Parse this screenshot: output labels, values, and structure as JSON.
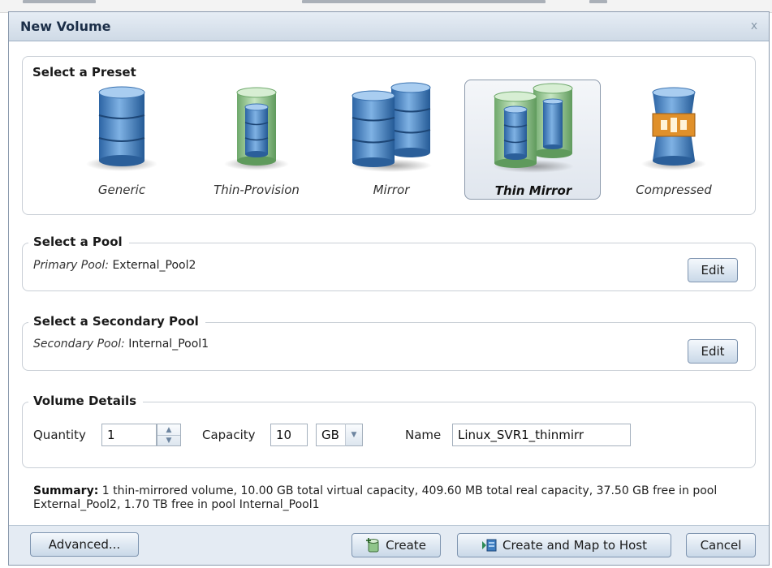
{
  "window": {
    "title": "New Volume",
    "close_glyph": "x"
  },
  "presets": {
    "heading": "Select a Preset",
    "items": [
      {
        "label": "Generic",
        "icon": "database-icon",
        "selected": false
      },
      {
        "label": "Thin-Provision",
        "icon": "thin-database-icon",
        "selected": false
      },
      {
        "label": "Mirror",
        "icon": "mirror-database-icon",
        "selected": false
      },
      {
        "label": "Thin Mirror",
        "icon": "thin-mirror-database-icon",
        "selected": true
      },
      {
        "label": "Compressed",
        "icon": "compressed-database-icon",
        "selected": false
      }
    ]
  },
  "pool": {
    "heading": "Select a Pool",
    "label": "Primary Pool:",
    "value": "External_Pool2",
    "edit_label": "Edit"
  },
  "secondary_pool": {
    "heading": "Select a Secondary Pool",
    "label": "Secondary Pool:",
    "value": "Internal_Pool1",
    "edit_label": "Edit"
  },
  "details": {
    "heading": "Volume Details",
    "quantity_label": "Quantity",
    "quantity_value": "1",
    "capacity_label": "Capacity",
    "capacity_value": "10",
    "unit_value": "GB",
    "name_label": "Name",
    "name_value": "Linux_SVR1_thinmirr"
  },
  "summary": {
    "label": "Summary:",
    "text": "1 thin-mirrored volume, 10.00 GB total virtual capacity, 409.60 MB total real capacity, 37.50 GB free in pool External_Pool2, 1.70 TB free in pool Internal_Pool1"
  },
  "footer": {
    "advanced_label": "Advanced...",
    "create_label": "Create",
    "create_map_label": "Create and Map to Host",
    "cancel_label": "Cancel"
  },
  "colors": {
    "blue_disk": "#3f7fc2",
    "green_disk": "#8fc58a",
    "compressed_band": "#e0902a",
    "title_text": "#1b2e48"
  }
}
